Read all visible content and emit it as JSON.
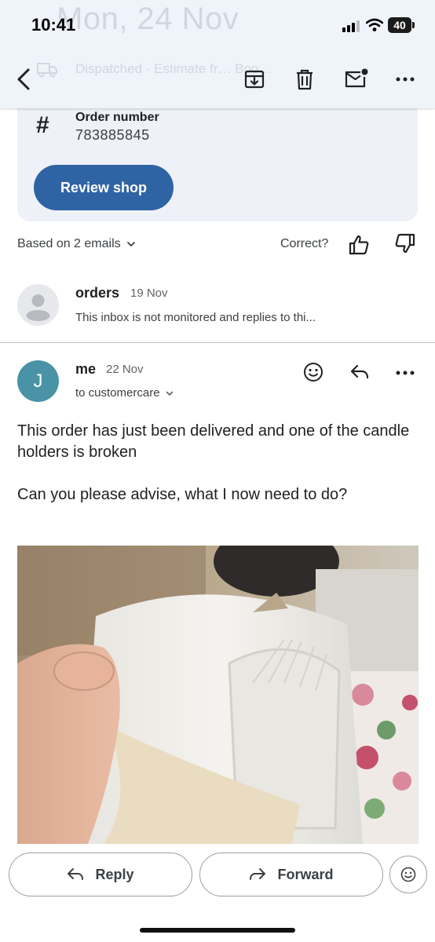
{
  "status_bar": {
    "time": "10:41",
    "battery": "40"
  },
  "header": {
    "background_date": "Mon, 24 Nov",
    "background_status": "Dispatched · Estimate fr… Boo…",
    "icons": [
      "back-arrow-icon",
      "archive-icon",
      "trash-icon",
      "mark-unread-icon",
      "more-icon"
    ]
  },
  "order_card": {
    "order_label": "Order number",
    "order_number": "783885845",
    "review_button": "Review shop"
  },
  "summary": {
    "based_on": "Based on 2 emails",
    "correct_label": "Correct?"
  },
  "messages": [
    {
      "sender": "orders",
      "date": "19 Nov",
      "snippet": "This inbox is not monitored and replies to thi..."
    },
    {
      "avatar_letter": "J",
      "sender": "me",
      "date": "22 Nov",
      "to": "to customercare",
      "body": [
        "This order has just been delivered and one of the candle holders is broken",
        "Can you please advise, what I now need to do?"
      ]
    }
  ],
  "actions": {
    "reply": "Reply",
    "forward": "Forward"
  },
  "colors": {
    "accent": "#2f64a4",
    "avatar_me": "#4a93a6",
    "card_bg": "#eef1f8"
  }
}
